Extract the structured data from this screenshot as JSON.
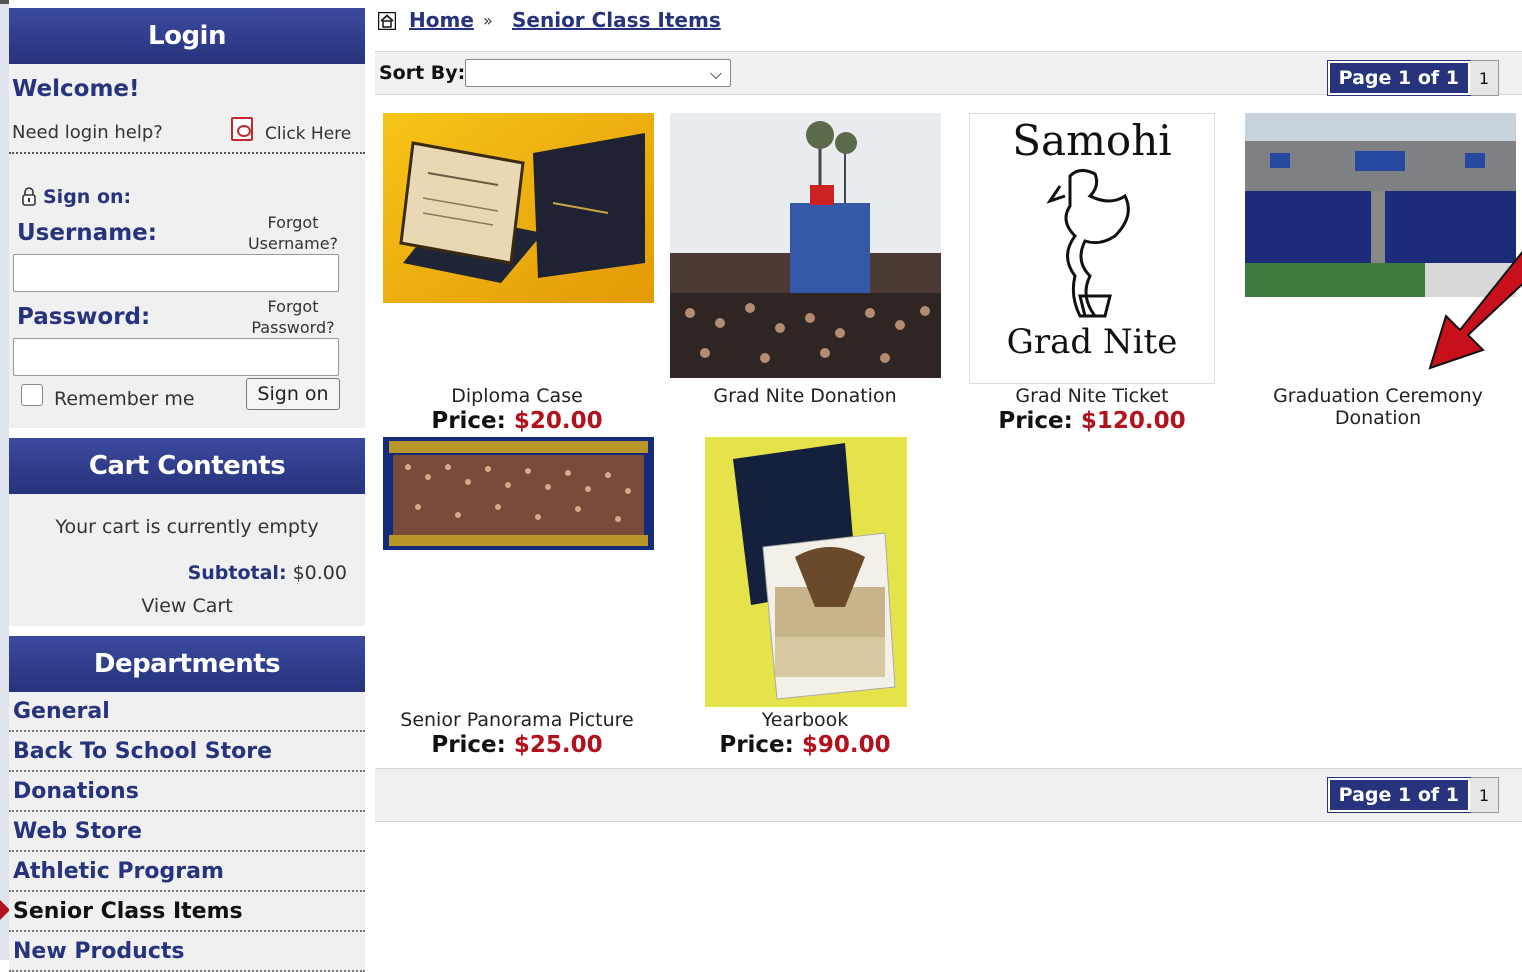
{
  "sidebar": {
    "login": {
      "title": "Login",
      "welcome": "Welcome!",
      "help_text": "Need login help?",
      "help_link": "Click Here",
      "sign_on_title": "Sign on:",
      "username_label": "Username:",
      "forgot_username": "Forgot Username?",
      "password_label": "Password:",
      "forgot_password": "Forgot Password?",
      "remember_label": "Remember me",
      "sign_on_button": "Sign on"
    },
    "cart": {
      "title": "Cart Contents",
      "empty_text": "Your cart is currently empty",
      "subtotal_label": "Subtotal:",
      "subtotal_value": "$0.00",
      "view_cart": "View Cart"
    },
    "departments": {
      "title": "Departments",
      "items": [
        {
          "label": "General"
        },
        {
          "label": "Back To School Store"
        },
        {
          "label": "Donations"
        },
        {
          "label": "Web Store"
        },
        {
          "label": "Athletic Program"
        },
        {
          "label": "Senior Class Items",
          "active": true
        },
        {
          "label": "New Products"
        }
      ]
    }
  },
  "breadcrumb": {
    "home": "Home",
    "separator": "»",
    "current": "Senior Class Items"
  },
  "toolbar": {
    "sort_label": "Sort By:",
    "sort_value": "",
    "pager_label": "Page 1 of 1",
    "pager_page": "1"
  },
  "products": [
    {
      "name": "Diploma Case",
      "price_label": "Price:",
      "price": "$20.00",
      "image": "diploma-case-photo"
    },
    {
      "name": "Grad Nite Donation",
      "image": "grad-nite-crowd-photo"
    },
    {
      "name": "Grad Nite Ticket",
      "price_label": "Price:",
      "price": "$120.00",
      "image": "samohi-grad-nite-logo",
      "image_text_top": "Samohi",
      "image_text_bottom": "Grad Nite"
    },
    {
      "name": "Graduation Ceremony Donation",
      "image": "graduation-ceremony-photo"
    },
    {
      "name": "Senior Panorama Picture",
      "price_label": "Price:",
      "price": "$25.00",
      "image": "senior-panorama-photo"
    },
    {
      "name": "Yearbook",
      "price_label": "Price:",
      "price": "$90.00",
      "image": "yearbook-photo"
    }
  ],
  "colors": {
    "brand": "#27337c",
    "price": "#b1121c",
    "panel_bg": "#f0f0f0",
    "annotation_arrow": "#c8101c"
  }
}
